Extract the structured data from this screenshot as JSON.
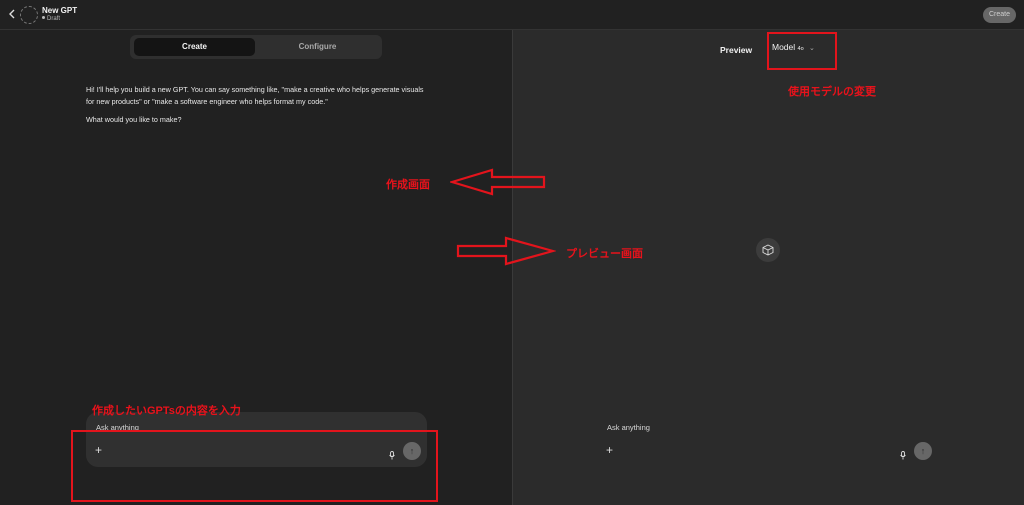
{
  "header": {
    "gpt_name": "New GPT",
    "gpt_status": "Draft",
    "create_button": "Create"
  },
  "tabs": {
    "create": "Create",
    "configure": "Configure"
  },
  "chat": {
    "assistant_message_1": "Hi! I'll help you build a new GPT. You can say something like, \"make a creative who helps generate visuals for new products\" or \"make a software engineer who helps format my code.\"",
    "assistant_message_2": "What would you like to make?"
  },
  "composer": {
    "placeholder": "Ask anything",
    "add_symbol": "+",
    "send_symbol": "↑"
  },
  "preview": {
    "label": "Preview",
    "model_label": "Model",
    "model_suffix": "4o",
    "composer_placeholder": "Ask anything",
    "add_symbol": "+",
    "send_symbol": "↑"
  },
  "annotations": {
    "model_change": "使用モデルの変更",
    "create_screen": "作成画面",
    "preview_screen": "プレビュー画面",
    "input_content": "作成したいGPTsの内容を入力"
  },
  "colors": {
    "annotation_red": "#e3141c",
    "left_background": "#212121",
    "right_background": "#2b2b2b"
  },
  "icons": [
    "back-arrow-icon",
    "gpt-avatar-icon",
    "plus-icon",
    "microphone-icon",
    "send-arrow-icon",
    "chevron-down-icon",
    "cube-icon"
  ]
}
